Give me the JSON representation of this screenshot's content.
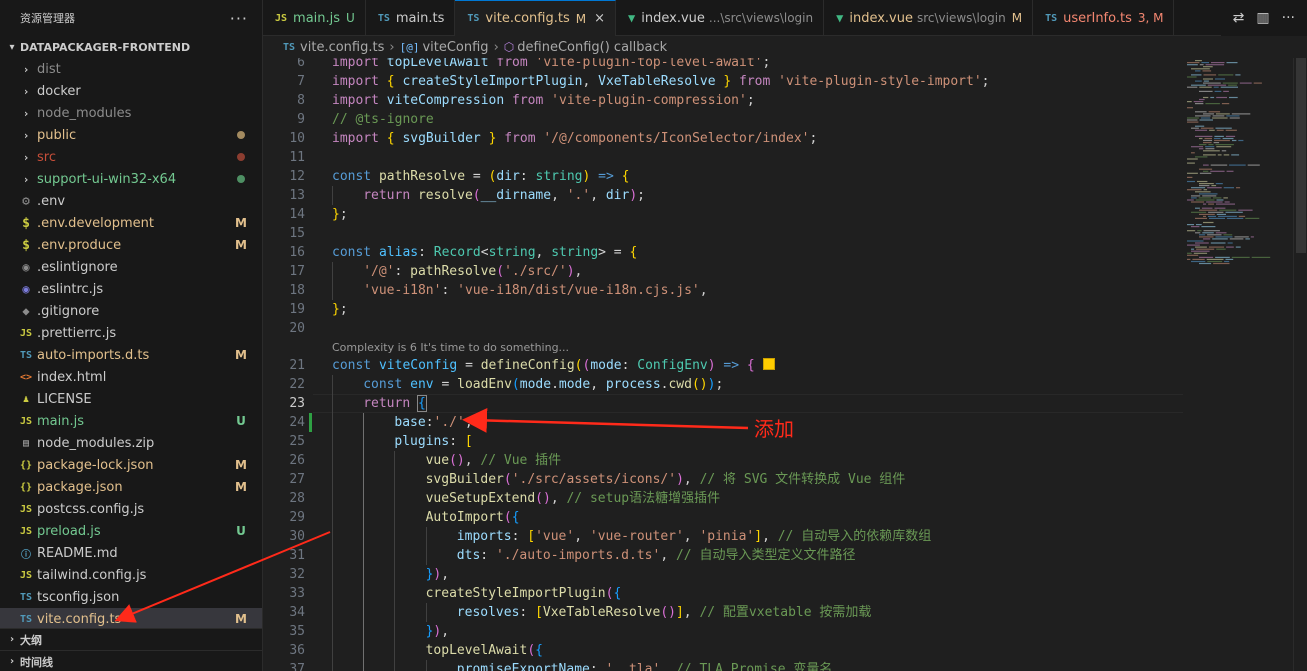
{
  "explorer": {
    "title": "资源管理器",
    "more": "···",
    "project": "DATAPACKAGER-FRONTEND",
    "outline": "大纲",
    "timeline": "时间线"
  },
  "files": [
    {
      "name": "dist",
      "kind": "folder",
      "color": "grey",
      "mark": ""
    },
    {
      "name": "docker",
      "kind": "folder",
      "color": "white",
      "mark": ""
    },
    {
      "name": "node_modules",
      "kind": "folder",
      "color": "grey",
      "mark": ""
    },
    {
      "name": "public",
      "kind": "folder",
      "color": "mod",
      "mark": "dot-mod"
    },
    {
      "name": "src",
      "kind": "folder",
      "color": "err",
      "mark": "dot-err"
    },
    {
      "name": "support-ui-win32-x64",
      "kind": "folder",
      "color": "untr",
      "mark": "dot-untr"
    },
    {
      "name": ".env",
      "kind": "gear",
      "color": "white",
      "mark": ""
    },
    {
      "name": ".env.development",
      "kind": "dollar",
      "color": "mod",
      "mark": "M"
    },
    {
      "name": ".env.produce",
      "kind": "dollar",
      "color": "mod",
      "mark": "M"
    },
    {
      "name": ".eslintignore",
      "kind": "eslint-grey",
      "color": "white",
      "mark": ""
    },
    {
      "name": ".eslintrc.js",
      "kind": "eslint",
      "color": "white",
      "mark": ""
    },
    {
      "name": ".gitignore",
      "kind": "git",
      "color": "white",
      "mark": ""
    },
    {
      "name": ".prettierrc.js",
      "kind": "js",
      "color": "white",
      "mark": ""
    },
    {
      "name": "auto-imports.d.ts",
      "kind": "ts",
      "color": "mod",
      "mark": "M"
    },
    {
      "name": "index.html",
      "kind": "html",
      "color": "white",
      "mark": ""
    },
    {
      "name": "LICENSE",
      "kind": "license",
      "color": "white",
      "mark": ""
    },
    {
      "name": "main.js",
      "kind": "js",
      "color": "untr",
      "mark": "U"
    },
    {
      "name": "node_modules.zip",
      "kind": "zip",
      "color": "white",
      "mark": ""
    },
    {
      "name": "package-lock.json",
      "kind": "json",
      "color": "mod",
      "mark": "M"
    },
    {
      "name": "package.json",
      "kind": "json",
      "color": "mod",
      "mark": "M"
    },
    {
      "name": "postcss.config.js",
      "kind": "js",
      "color": "white",
      "mark": ""
    },
    {
      "name": "preload.js",
      "kind": "js",
      "color": "untr",
      "mark": "U"
    },
    {
      "name": "README.md",
      "kind": "md",
      "color": "white",
      "mark": ""
    },
    {
      "name": "tailwind.config.js",
      "kind": "js",
      "color": "white",
      "mark": ""
    },
    {
      "name": "tsconfig.json",
      "kind": "tsjson",
      "color": "white",
      "mark": ""
    },
    {
      "name": "vite.config.ts",
      "kind": "ts",
      "color": "mod",
      "mark": "M",
      "selected": true
    }
  ],
  "tabs": [
    {
      "icon": "JS",
      "icon_kind": "js",
      "label": "main.js",
      "badge": "U",
      "label_color": "untr",
      "badge_color": "untr",
      "desc": "",
      "active": false
    },
    {
      "icon": "TS",
      "icon_kind": "ts",
      "label": "main.ts",
      "badge": "",
      "label_color": "white",
      "badge_color": "",
      "desc": "",
      "active": false
    },
    {
      "icon": "TS",
      "icon_kind": "ts",
      "label": "vite.config.ts",
      "badge": "M",
      "label_color": "mod",
      "badge_color": "mod",
      "desc": "",
      "active": true,
      "close": "×"
    },
    {
      "icon": "V",
      "icon_kind": "vue",
      "label": "index.vue",
      "badge": "",
      "label_color": "white",
      "badge_color": "",
      "desc": "...\\src\\views\\login",
      "active": false
    },
    {
      "icon": "V",
      "icon_kind": "vue",
      "label": "index.vue",
      "badge": "M",
      "label_color": "mod",
      "badge_color": "mod",
      "desc": "src\\views\\login",
      "active": false
    },
    {
      "icon": "TS",
      "icon_kind": "ts",
      "label": "userInfo.ts",
      "badge": "3, M",
      "label_color": "err",
      "badge_color": "err",
      "desc": "",
      "active": false
    }
  ],
  "tab_action_icons": [
    "compare-changes-icon",
    "split-editor-icon",
    "more-actions-icon"
  ],
  "breadcrumb": {
    "file_icon": "TS",
    "file": "vite.config.ts",
    "sym1_icon": "[@]",
    "sym1": "viteConfig",
    "sym2": "defineConfig() callback",
    "sep": "›"
  },
  "codelens": {
    "after_line": 20,
    "text": "Complexity is 6 It's time to do something..."
  },
  "current_line": 23,
  "modified_line": 24,
  "annotation": {
    "label": "添加"
  },
  "code": [
    {
      "n": 6,
      "indent": 0,
      "tokens": [
        [
          "kw",
          "import"
        ],
        [
          "pl",
          " "
        ],
        [
          "vr",
          "topLevelAwait"
        ],
        [
          "pl",
          " "
        ],
        [
          "kw",
          "from"
        ],
        [
          "pl",
          " "
        ],
        [
          "st",
          "'vite-plugin-top-level-await'"
        ],
        [
          "pl",
          ";"
        ]
      ]
    },
    {
      "n": 7,
      "indent": 0,
      "tokens": [
        [
          "kw",
          "import"
        ],
        [
          "pl",
          " "
        ],
        [
          "p1",
          "{"
        ],
        [
          "pl",
          " "
        ],
        [
          "vr",
          "createStyleImportPlugin"
        ],
        [
          "pl",
          ", "
        ],
        [
          "vr",
          "VxeTableResolve"
        ],
        [
          "pl",
          " "
        ],
        [
          "p1",
          "}"
        ],
        [
          "pl",
          " "
        ],
        [
          "kw",
          "from"
        ],
        [
          "pl",
          " "
        ],
        [
          "st",
          "'vite-plugin-style-import'"
        ],
        [
          "pl",
          ";"
        ]
      ]
    },
    {
      "n": 8,
      "indent": 0,
      "tokens": [
        [
          "kw",
          "import"
        ],
        [
          "pl",
          " "
        ],
        [
          "vr",
          "viteCompression"
        ],
        [
          "pl",
          " "
        ],
        [
          "kw",
          "from"
        ],
        [
          "pl",
          " "
        ],
        [
          "st",
          "'vite-plugin-compression'"
        ],
        [
          "pl",
          ";"
        ]
      ]
    },
    {
      "n": 9,
      "indent": 0,
      "tokens": [
        [
          "cm",
          "// @ts-ignore"
        ]
      ]
    },
    {
      "n": 10,
      "indent": 0,
      "tokens": [
        [
          "kw",
          "import"
        ],
        [
          "pl",
          " "
        ],
        [
          "p1",
          "{"
        ],
        [
          "pl",
          " "
        ],
        [
          "vr",
          "svgBuilder"
        ],
        [
          "pl",
          " "
        ],
        [
          "p1",
          "}"
        ],
        [
          "pl",
          " "
        ],
        [
          "kw",
          "from"
        ],
        [
          "pl",
          " "
        ],
        [
          "st",
          "'/@/components/IconSelector/index'"
        ],
        [
          "pl",
          ";"
        ]
      ]
    },
    {
      "n": 11,
      "indent": 0,
      "tokens": []
    },
    {
      "n": 12,
      "indent": 0,
      "tokens": [
        [
          "dk",
          "const"
        ],
        [
          "pl",
          " "
        ],
        [
          "fn",
          "pathResolve"
        ],
        [
          "pl",
          " = "
        ],
        [
          "p1",
          "("
        ],
        [
          "vr",
          "dir"
        ],
        [
          "pl",
          ": "
        ],
        [
          "ty",
          "string"
        ],
        [
          "p1",
          ")"
        ],
        [
          "pl",
          " "
        ],
        [
          "dk",
          "=>"
        ],
        [
          "pl",
          " "
        ],
        [
          "p1",
          "{"
        ]
      ]
    },
    {
      "n": 13,
      "indent": 1,
      "tokens": [
        [
          "kw",
          "return"
        ],
        [
          "pl",
          " "
        ],
        [
          "fn",
          "resolve"
        ],
        [
          "p2",
          "("
        ],
        [
          "vr",
          "__dirname"
        ],
        [
          "pl",
          ", "
        ],
        [
          "st",
          "'.'"
        ],
        [
          "pl",
          ", "
        ],
        [
          "vr",
          "dir"
        ],
        [
          "p2",
          ")"
        ],
        [
          "pl",
          ";"
        ]
      ]
    },
    {
      "n": 14,
      "indent": 0,
      "tokens": [
        [
          "p1",
          "}"
        ],
        [
          "pl",
          ";"
        ]
      ]
    },
    {
      "n": 15,
      "indent": 0,
      "tokens": []
    },
    {
      "n": 16,
      "indent": 0,
      "tokens": [
        [
          "dk",
          "const"
        ],
        [
          "pl",
          " "
        ],
        [
          "co",
          "alias"
        ],
        [
          "pl",
          ": "
        ],
        [
          "ty",
          "Record"
        ],
        [
          "pl",
          "<"
        ],
        [
          "ty",
          "string"
        ],
        [
          "pl",
          ", "
        ],
        [
          "ty",
          "string"
        ],
        [
          "pl",
          "> = "
        ],
        [
          "p1",
          "{"
        ]
      ]
    },
    {
      "n": 17,
      "indent": 1,
      "tokens": [
        [
          "st",
          "'/@'"
        ],
        [
          "pl",
          ": "
        ],
        [
          "fn",
          "pathResolve"
        ],
        [
          "p2",
          "("
        ],
        [
          "st",
          "'./src/'"
        ],
        [
          "p2",
          ")"
        ],
        [
          "pl",
          ","
        ]
      ]
    },
    {
      "n": 18,
      "indent": 1,
      "tokens": [
        [
          "st",
          "'vue-i18n'"
        ],
        [
          "pl",
          ": "
        ],
        [
          "st",
          "'vue-i18n/dist/vue-i18n.cjs.js'"
        ],
        [
          "pl",
          ","
        ]
      ]
    },
    {
      "n": 19,
      "indent": 0,
      "tokens": [
        [
          "p1",
          "}"
        ],
        [
          "pl",
          ";"
        ]
      ]
    },
    {
      "n": 20,
      "indent": 0,
      "tokens": []
    },
    {
      "n": 21,
      "indent": 0,
      "tokens": [
        [
          "dk",
          "const"
        ],
        [
          "pl",
          " "
        ],
        [
          "co",
          "viteConfig"
        ],
        [
          "pl",
          " = "
        ],
        [
          "fn",
          "defineConfig"
        ],
        [
          "p1",
          "("
        ],
        [
          "p2",
          "("
        ],
        [
          "vr",
          "mode"
        ],
        [
          "pl",
          ": "
        ],
        [
          "ty",
          "ConfigEnv"
        ],
        [
          "p2",
          ")"
        ],
        [
          "pl",
          " "
        ],
        [
          "dk",
          "=>"
        ],
        [
          "pl",
          " "
        ],
        [
          "p2",
          "{"
        ],
        [
          "pl",
          " "
        ],
        [
          "sq",
          ""
        ]
      ]
    },
    {
      "n": 22,
      "indent": 1,
      "tokens": [
        [
          "dk",
          "const"
        ],
        [
          "pl",
          " "
        ],
        [
          "co",
          "env"
        ],
        [
          "pl",
          " = "
        ],
        [
          "fn",
          "loadEnv"
        ],
        [
          "p3",
          "("
        ],
        [
          "vr",
          "mode"
        ],
        [
          "pl",
          "."
        ],
        [
          "vr",
          "mode"
        ],
        [
          "pl",
          ", "
        ],
        [
          "vr",
          "process"
        ],
        [
          "pl",
          "."
        ],
        [
          "fn",
          "cwd"
        ],
        [
          "p1",
          "()"
        ],
        [
          "p3",
          ")"
        ],
        [
          "pl",
          ";"
        ]
      ]
    },
    {
      "n": 23,
      "indent": 1,
      "tokens": [
        [
          "kw",
          "return"
        ],
        [
          "pl",
          " "
        ],
        [
          "p3b",
          "{"
        ]
      ]
    },
    {
      "n": 24,
      "indent": 2,
      "tokens": [
        [
          "vr",
          "base"
        ],
        [
          "pl",
          ":"
        ],
        [
          "st",
          "'./'"
        ],
        [
          "pl",
          ","
        ]
      ]
    },
    {
      "n": 25,
      "indent": 2,
      "tokens": [
        [
          "vr",
          "plugins"
        ],
        [
          "pl",
          ": "
        ],
        [
          "p1",
          "["
        ]
      ]
    },
    {
      "n": 26,
      "indent": 3,
      "tokens": [
        [
          "fn",
          "vue"
        ],
        [
          "p2",
          "()"
        ],
        [
          "pl",
          ", "
        ],
        [
          "cm",
          "// Vue 插件"
        ]
      ]
    },
    {
      "n": 27,
      "indent": 3,
      "tokens": [
        [
          "fn",
          "svgBuilder"
        ],
        [
          "p2",
          "("
        ],
        [
          "st",
          "'./src/assets/icons/'"
        ],
        [
          "p2",
          ")"
        ],
        [
          "pl",
          ", "
        ],
        [
          "cm",
          "// 将 SVG 文件转换成 Vue 组件"
        ]
      ]
    },
    {
      "n": 28,
      "indent": 3,
      "tokens": [
        [
          "fn",
          "vueSetupExtend"
        ],
        [
          "p2",
          "()"
        ],
        [
          "pl",
          ", "
        ],
        [
          "cm",
          "// setup语法糖增强插件"
        ]
      ]
    },
    {
      "n": 29,
      "indent": 3,
      "tokens": [
        [
          "fn",
          "AutoImport"
        ],
        [
          "p2",
          "("
        ],
        [
          "p3",
          "{"
        ]
      ]
    },
    {
      "n": 30,
      "indent": 4,
      "tokens": [
        [
          "vr",
          "imports"
        ],
        [
          "pl",
          ": "
        ],
        [
          "p1",
          "["
        ],
        [
          "st",
          "'vue'"
        ],
        [
          "pl",
          ", "
        ],
        [
          "st",
          "'vue-router'"
        ],
        [
          "pl",
          ", "
        ],
        [
          "st",
          "'pinia'"
        ],
        [
          "p1",
          "]"
        ],
        [
          "pl",
          ", "
        ],
        [
          "cm",
          "// 自动导入的依赖库数组"
        ]
      ]
    },
    {
      "n": 31,
      "indent": 4,
      "tokens": [
        [
          "vr",
          "dts"
        ],
        [
          "pl",
          ": "
        ],
        [
          "st",
          "'./auto-imports.d.ts'"
        ],
        [
          "pl",
          ", "
        ],
        [
          "cm",
          "// 自动导入类型定义文件路径"
        ]
      ]
    },
    {
      "n": 32,
      "indent": 3,
      "tokens": [
        [
          "p3",
          "}"
        ],
        [
          "p2",
          ")"
        ],
        [
          "pl",
          ","
        ]
      ]
    },
    {
      "n": 33,
      "indent": 3,
      "tokens": [
        [
          "fn",
          "createStyleImportPlugin"
        ],
        [
          "p2",
          "("
        ],
        [
          "p3",
          "{"
        ]
      ]
    },
    {
      "n": 34,
      "indent": 4,
      "tokens": [
        [
          "vr",
          "resolves"
        ],
        [
          "pl",
          ": "
        ],
        [
          "p1",
          "["
        ],
        [
          "fn",
          "VxeTableResolve"
        ],
        [
          "p2",
          "()"
        ],
        [
          "p1",
          "]"
        ],
        [
          "pl",
          ", "
        ],
        [
          "cm",
          "// 配置vxetable 按需加载"
        ]
      ]
    },
    {
      "n": 35,
      "indent": 3,
      "tokens": [
        [
          "p3",
          "}"
        ],
        [
          "p2",
          ")"
        ],
        [
          "pl",
          ","
        ]
      ]
    },
    {
      "n": 36,
      "indent": 3,
      "tokens": [
        [
          "fn",
          "topLevelAwait"
        ],
        [
          "p2",
          "("
        ],
        [
          "p3",
          "{"
        ]
      ]
    },
    {
      "n": 37,
      "indent": 4,
      "tokens": [
        [
          "vr",
          "promiseExportName"
        ],
        [
          "pl",
          ": "
        ],
        [
          "st",
          "'__tla'"
        ],
        [
          "pl",
          ", "
        ],
        [
          "cm",
          "// TLA Promise 变量名"
        ]
      ]
    }
  ]
}
